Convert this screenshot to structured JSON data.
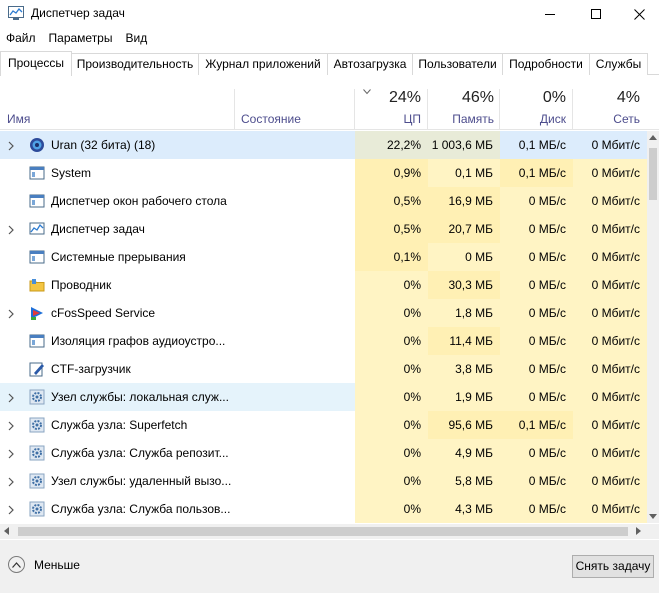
{
  "window": {
    "title": "Диспетчер задач"
  },
  "menu": [
    "Файл",
    "Параметры",
    "Вид"
  ],
  "tabs": [
    "Процессы",
    "Производительность",
    "Журнал приложений",
    "Автозагрузка",
    "Пользователи",
    "Подробности",
    "Службы"
  ],
  "active_tab": "Процессы",
  "columns": {
    "name": "Имя",
    "state": "Состояние",
    "cpu": {
      "percent": "24%",
      "label": "ЦП"
    },
    "memory": {
      "percent": "46%",
      "label": "Память"
    },
    "disk": {
      "percent": "0%",
      "label": "Диск"
    },
    "network": {
      "percent": "4%",
      "label": "Сеть"
    }
  },
  "colors": {
    "selection": "#dcecfc",
    "heat_light": "#fff4c4",
    "heat_medium": "#ffe8a0",
    "heat_strong": "#fce9a6",
    "header_text": "#4d4d8d"
  },
  "processes": [
    {
      "name": "Uran (32 бита) (18)",
      "icon": "globe-icon",
      "expandable": true,
      "cpu": "22,2%",
      "memory": "1 003,6 МБ",
      "disk": "0,1 МБ/с",
      "network": "0 Мбит/с",
      "selected": true
    },
    {
      "name": "System",
      "icon": "window-icon",
      "expandable": false,
      "cpu": "0,9%",
      "memory": "0,1 МБ",
      "disk": "0,1 МБ/с",
      "network": "0 Мбит/с"
    },
    {
      "name": "Диспетчер окон рабочего стола",
      "icon": "window-icon",
      "expandable": false,
      "cpu": "0,5%",
      "memory": "16,9 МБ",
      "disk": "0 МБ/с",
      "network": "0 Мбит/с"
    },
    {
      "name": "Диспетчер задач",
      "icon": "taskmgr-icon",
      "expandable": true,
      "cpu": "0,5%",
      "memory": "20,7 МБ",
      "disk": "0 МБ/с",
      "network": "0 Мбит/с"
    },
    {
      "name": "Системные прерывания",
      "icon": "window-icon",
      "expandable": false,
      "cpu": "0,1%",
      "memory": "0 МБ",
      "disk": "0 МБ/с",
      "network": "0 Мбит/с"
    },
    {
      "name": "Проводник",
      "icon": "folder-icon",
      "expandable": false,
      "cpu": "0%",
      "memory": "30,3 МБ",
      "disk": "0 МБ/с",
      "network": "0 Мбит/с"
    },
    {
      "name": "cFosSpeed Service",
      "icon": "cfos-icon",
      "expandable": true,
      "cpu": "0%",
      "memory": "1,8 МБ",
      "disk": "0 МБ/с",
      "network": "0 Мбит/с"
    },
    {
      "name": "Изоляция графов аудиоустро...",
      "icon": "window-icon",
      "expandable": false,
      "cpu": "0%",
      "memory": "11,4 МБ",
      "disk": "0 МБ/с",
      "network": "0 Мбит/с"
    },
    {
      "name": "CTF-загрузчик",
      "icon": "pen-icon",
      "expandable": false,
      "cpu": "0%",
      "memory": "3,8 МБ",
      "disk": "0 МБ/с",
      "network": "0 Мбит/с"
    },
    {
      "name": "Узел службы: локальная служ...",
      "icon": "gear-icon",
      "expandable": true,
      "cpu": "0%",
      "memory": "1,9 МБ",
      "disk": "0 МБ/с",
      "network": "0 Мбит/с",
      "hover": true
    },
    {
      "name": "Служба узла: Superfetch",
      "icon": "gear-icon",
      "expandable": true,
      "cpu": "0%",
      "memory": "95,6 МБ",
      "disk": "0,1 МБ/с",
      "network": "0 Мбит/с"
    },
    {
      "name": "Служба узла: Служба репозит...",
      "icon": "gear-icon",
      "expandable": true,
      "cpu": "0%",
      "memory": "4,9 МБ",
      "disk": "0 МБ/с",
      "network": "0 Мбит/с"
    },
    {
      "name": "Узел службы: удаленный вызо...",
      "icon": "gear-icon",
      "expandable": true,
      "cpu": "0%",
      "memory": "5,8 МБ",
      "disk": "0 МБ/с",
      "network": "0 Мбит/с"
    },
    {
      "name": "Служба узла: Служба пользов...",
      "icon": "gear-icon",
      "expandable": true,
      "cpu": "0%",
      "memory": "4,3 МБ",
      "disk": "0 МБ/с",
      "network": "0 Мбит/с"
    }
  ],
  "footer": {
    "less_label": "Меньше",
    "end_task_label": "Снять задачу"
  }
}
